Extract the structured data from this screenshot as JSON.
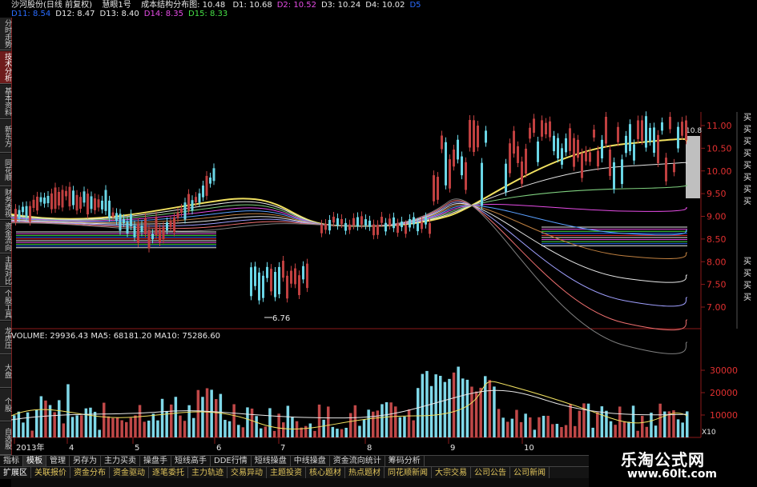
{
  "header": {
    "stock": "沙河股份(日线 前复权)",
    "formula": "慧眼1号",
    "cost": "成本结构分布图: 10.48",
    "d_values": [
      {
        "label": "D1: 10.68",
        "color": "#e8e8e8"
      },
      {
        "label": "D2: 10.52",
        "color": "#e64ce6"
      },
      {
        "label": "D3: 10.24",
        "color": "#e8e8e8"
      },
      {
        "label": "D4: 10.02",
        "color": "#e8e8e8"
      },
      {
        "label": "D5",
        "color": "#2a6cff"
      }
    ],
    "d_row2": [
      {
        "label": "D11: 8.54",
        "color": "#2a6cff"
      },
      {
        "label": "D12: 8.47",
        "color": "#e8e8e8"
      },
      {
        "label": "D13: 8.40",
        "color": "#e8e8e8"
      },
      {
        "label": "D14: 8.35",
        "color": "#e64ce6"
      },
      {
        "label": "D15: 8.33",
        "color": "#46e046"
      }
    ]
  },
  "left_tabs": [
    {
      "label": "分时走势",
      "active": false
    },
    {
      "label": "技术分析",
      "active": true
    },
    {
      "label": "基本资料",
      "active": false
    },
    {
      "label": "新东方",
      "active": false
    },
    {
      "label": "同花顺",
      "active": false
    },
    {
      "label": "财务透视",
      "active": false
    },
    {
      "label": "资金流向",
      "active": false
    },
    {
      "label": "主题对比",
      "active": false
    },
    {
      "label": "个股工具",
      "active": false
    },
    {
      "label": "龙虎庄",
      "active": false
    },
    {
      "label": "大盘",
      "active": false
    },
    {
      "label": "个股",
      "active": false
    },
    {
      "label": "自选股",
      "active": false
    }
  ],
  "price_axis": {
    "ticks": [
      "11.00",
      "10.50",
      "10.00",
      "9.50",
      "9.00",
      "8.50",
      "8.00",
      "7.50",
      "7.00"
    ],
    "marker": "10.8"
  },
  "volume": {
    "header": "VOLUME: 29936.43  MA5: 68181.20  MA10: 75286.60",
    "ticks": [
      "30000",
      "20000",
      "10000"
    ],
    "unit": "X10"
  },
  "low_label": "6.76",
  "months": [
    "2013年",
    "4",
    "5",
    "6",
    "7",
    "8",
    "9",
    "10"
  ],
  "buy_labels": [
    "买",
    "买",
    "买",
    "买",
    "买",
    "买",
    "买",
    "买",
    "",
    "",
    "",
    "",
    "买",
    "买",
    "买",
    "买"
  ],
  "tabs_row1": [
    {
      "label": "指标",
      "active": false
    },
    {
      "label": "模板",
      "active": true
    },
    {
      "label": "管理",
      "active": false
    },
    {
      "label": "另存为",
      "active": false
    },
    {
      "label": "主力买卖",
      "active": false
    },
    {
      "label": "操盘手",
      "active": false
    },
    {
      "label": "短线高手",
      "active": false
    },
    {
      "label": "DDE行情",
      "active": false
    },
    {
      "label": "短线操盘",
      "active": false
    },
    {
      "label": "中线操盘",
      "active": false
    },
    {
      "label": "资金流向统计",
      "active": false
    },
    {
      "label": "筹码分析",
      "active": false
    }
  ],
  "tabs_row2": [
    {
      "label": "扩展区",
      "active": true
    },
    {
      "label": "关联报价",
      "active": false
    },
    {
      "label": "资金分布",
      "active": false
    },
    {
      "label": "资金驱动",
      "active": false
    },
    {
      "label": "逐笔委托",
      "active": false
    },
    {
      "label": "主力轨迹",
      "active": false
    },
    {
      "label": "交易异动",
      "active": false
    },
    {
      "label": "主题投资",
      "active": false
    },
    {
      "label": "核心题材",
      "active": false
    },
    {
      "label": "热点题材",
      "active": false
    },
    {
      "label": "同花顺新闻",
      "active": false
    },
    {
      "label": "大宗交易",
      "active": false
    },
    {
      "label": "公司公告",
      "active": false
    },
    {
      "label": "公司新闻",
      "active": false
    }
  ],
  "watermark": {
    "title": "乐淘公式网",
    "url": "www.60lt.com"
  },
  "chart_data": {
    "type": "bar",
    "title": "",
    "series": [
      {
        "name": "VOLUME",
        "values": [
          29936.43
        ]
      },
      {
        "name": "MA5",
        "values": [
          68181.2
        ]
      },
      {
        "name": "MA10",
        "values": [
          75286.6
        ]
      }
    ],
    "ylim_price": [
      7.0,
      11.0
    ],
    "ylim_volume": [
      0,
      30000
    ]
  }
}
